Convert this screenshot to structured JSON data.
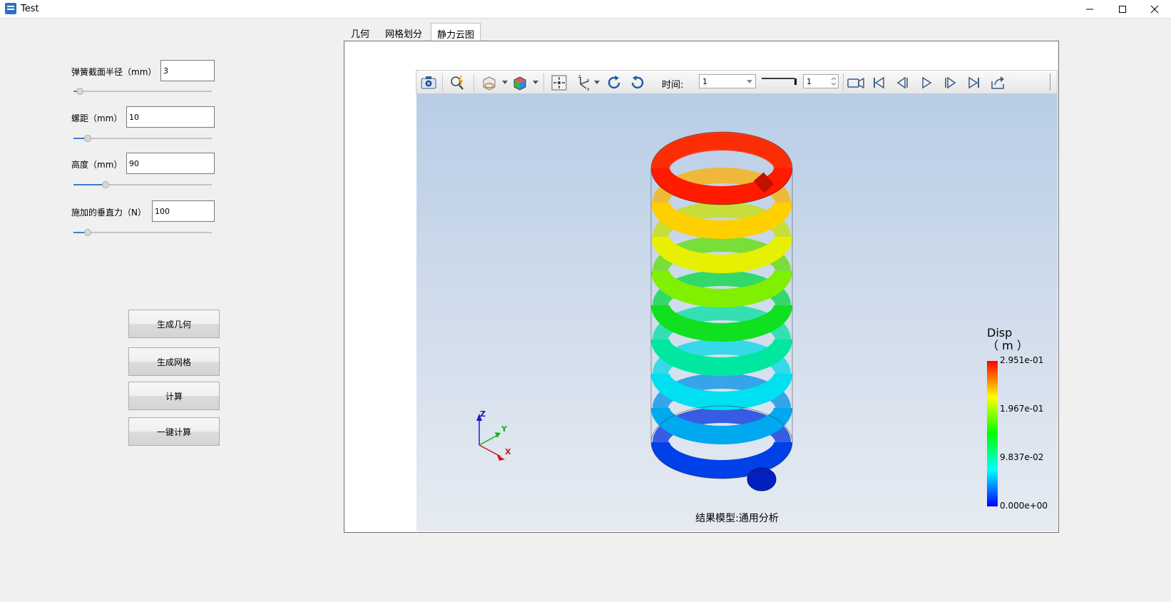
{
  "window": {
    "title": "Test"
  },
  "params": [
    {
      "label": "弹簧截面半径（mm）",
      "value": "3",
      "slider_fraction": 0.02
    },
    {
      "label": "螺距（mm）",
      "value": "10",
      "slider_fraction": 0.08
    },
    {
      "label": "高度（mm）",
      "value": "90",
      "slider_fraction": 0.22
    },
    {
      "label": "施加的垂直力（N）",
      "value": "100",
      "slider_fraction": 0.08
    }
  ],
  "buttons": {
    "gen_geometry": "生成几何",
    "gen_mesh": "生成网格",
    "compute": "计算",
    "one_click": "一键计算"
  },
  "tabs": [
    {
      "label": "几何",
      "active": false
    },
    {
      "label": "网格划分",
      "active": false
    },
    {
      "label": "静力云图",
      "active": true
    }
  ],
  "toolbar": {
    "time_label": "时间:",
    "time_combo_value": "1",
    "frame_value": "1",
    "icons": [
      "camera-icon",
      "zoom-icon",
      "display-mode-icon",
      "color-cube-icon",
      "fit-view-icon",
      "axis-view-icon",
      "rotate-cw-icon",
      "rotate-ccw-icon",
      "record-icon",
      "first-frame-icon",
      "prev-frame-icon",
      "play-icon",
      "next-frame-icon",
      "last-frame-icon",
      "export-icon"
    ]
  },
  "viewport": {
    "footer": "结果模型:通用分析",
    "axes": {
      "z": "Z",
      "y": "Y",
      "x": "X"
    },
    "legend": {
      "title_line1": "Disp",
      "title_line2": "（ m ）",
      "max": "2.951e-01",
      "v2": "1.967e-01",
      "v3": "9.837e-02",
      "min": "0.000e+00",
      "colors": [
        "#ff0000",
        "#ffff00",
        "#00ff00",
        "#00ffff",
        "#0000ff"
      ]
    }
  }
}
